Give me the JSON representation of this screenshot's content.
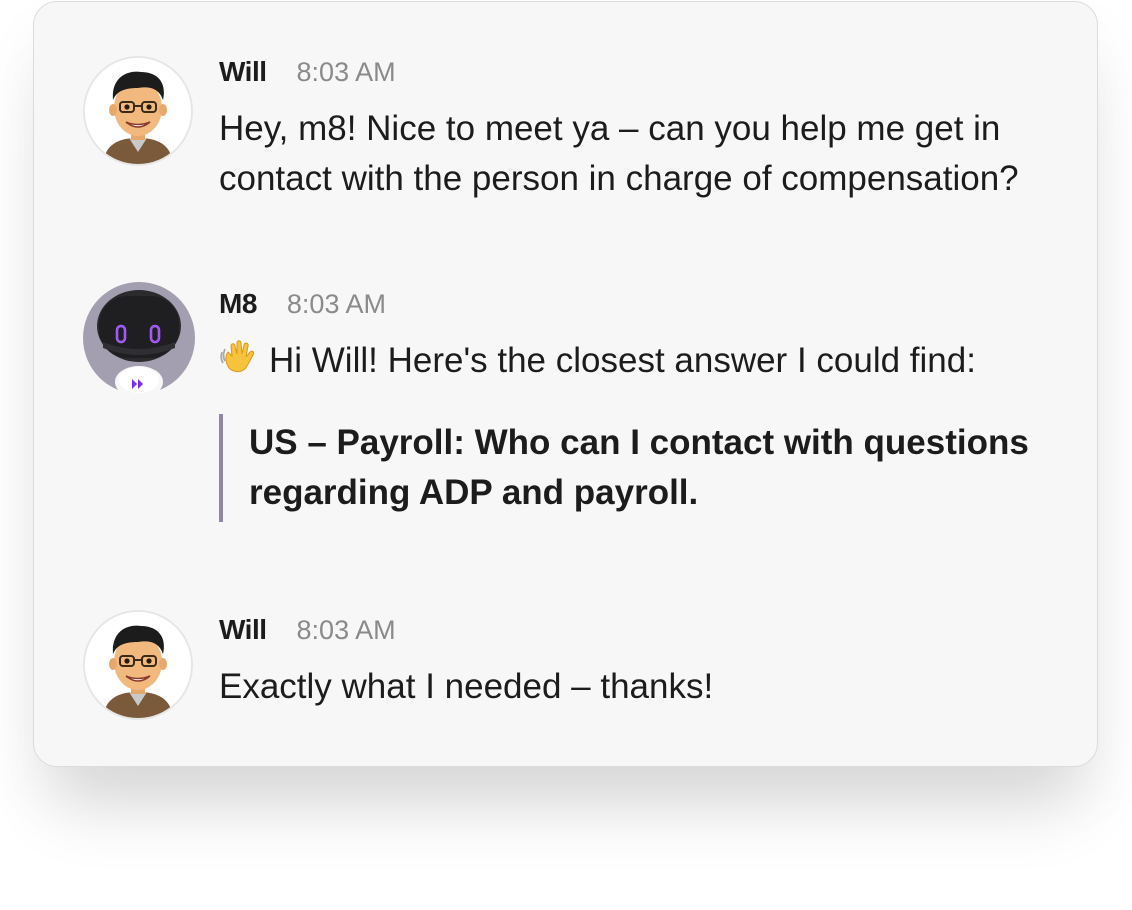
{
  "messages": [
    {
      "author": "Will",
      "time": "8:03 AM",
      "text": "Hey, m8! Nice to meet ya – can you help me get in contact with the person in charge of compensation?",
      "avatar_icon": "memoji-avatar"
    },
    {
      "author": "M8",
      "time": "8:03 AM",
      "text": "Hi Will! Here's the closest answer I could find:",
      "emoji_icon": "waving-hand-icon",
      "quote": "US – Payroll: Who can I contact with questions regarding ADP and payroll.",
      "avatar_icon": "robot-avatar",
      "badge_icon": "fast-forward-icon"
    },
    {
      "author": "Will",
      "time": "8:03 AM",
      "text": "Exactly what I needed – thanks!",
      "avatar_icon": "memoji-avatar"
    }
  ],
  "colors": {
    "card_bg": "#f7f7f7",
    "quote_bar": "#8f86a6",
    "bot_eyes": "#a35cff",
    "timestamp": "#8a8a8a"
  }
}
